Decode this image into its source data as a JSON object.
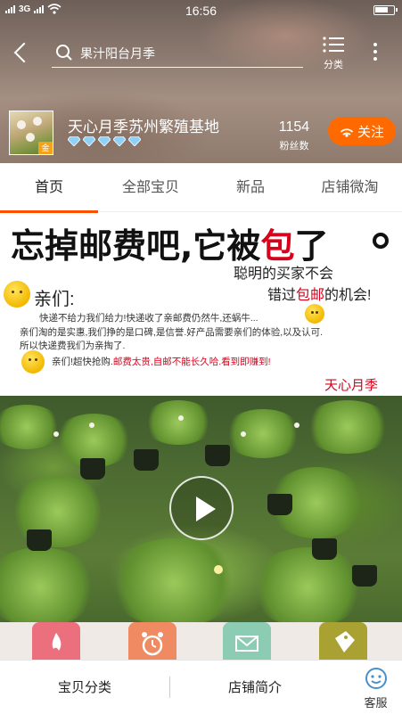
{
  "status_bar": {
    "time": "16:56",
    "network": "3G"
  },
  "header": {
    "search_text": "果汁阳台月季",
    "category_label": "分类",
    "icons": [
      "back-arrow-icon",
      "search-icon",
      "list-icon",
      "more-vertical-icon"
    ]
  },
  "shop": {
    "name": "天心月季苏州繁殖基地",
    "logo_badge": "金",
    "diamond_count": 5,
    "fans_count": "1154",
    "fans_label": "粉丝数",
    "follow_label": "关注",
    "accent_color": "#ff6a00"
  },
  "tabs": [
    {
      "label": "首页",
      "active": true
    },
    {
      "label": "全部宝贝",
      "active": false
    },
    {
      "label": "新品",
      "active": false
    },
    {
      "label": "店铺微淘",
      "active": false
    }
  ],
  "banner": {
    "headline_a": "忘掉邮费吧,它被",
    "headline_red": "包",
    "headline_b": "了",
    "sub1": "聪明的买家不会",
    "sub2_a": "错过",
    "sub2_red": "包邮",
    "sub2_b": "的机会!",
    "dear": "亲们:",
    "line1": "快递不给力我们给力!快递收了亲邮费仍然牛,还蜗牛...",
    "line2": "亲们淘的是实惠,我们挣的是口碑,是信誉.好产品需要亲们的体验,以及认可.",
    "line3": "所以快递费我们为亲掏了.",
    "line4_a": "亲们!超快抢购.",
    "line4_red": "邮费太贵,自邮不能长久哈.看到即赚到!",
    "signature": "天心月季"
  },
  "video": {
    "play_icon": "play-icon"
  },
  "bottom_bar": {
    "category_label": "宝贝分类",
    "intro_label": "店铺简介",
    "service_label": "客服"
  }
}
